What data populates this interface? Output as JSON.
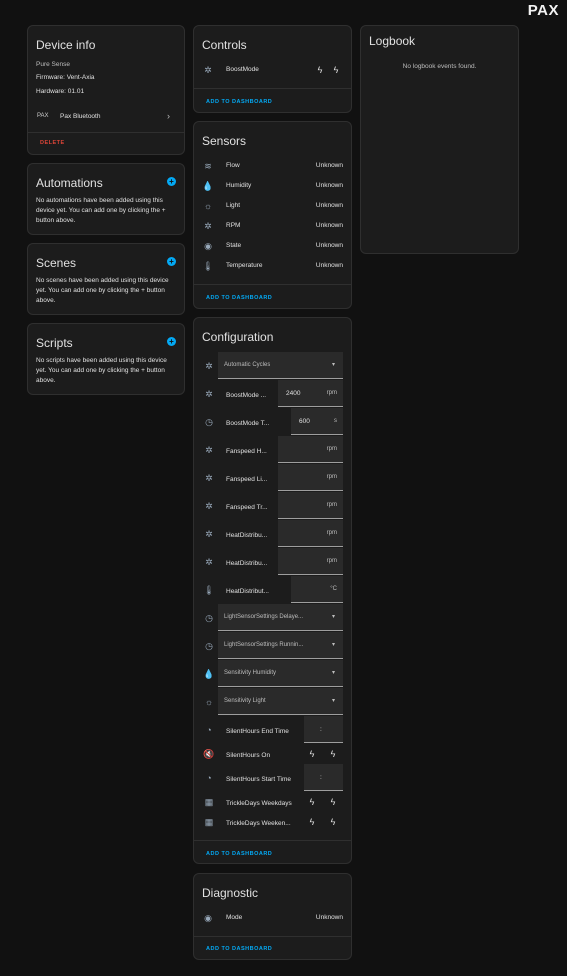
{
  "brand": {
    "logo_text": "PAX"
  },
  "device_info": {
    "title": "Device info",
    "model": "Pure Sense",
    "firmware": "Firmware: Vent-Axia",
    "hardware": "Hardware: 01.01",
    "integration_logo": "PAX",
    "integration_name": "Pax Bluetooth",
    "delete_label": "DELETE"
  },
  "automations": {
    "title": "Automations",
    "text": "No automations have been added using this device yet. You can add one by clicking the + button above."
  },
  "scenes": {
    "title": "Scenes",
    "text": "No scenes have been added using this device yet. You can add one by clicking the + button above."
  },
  "scripts": {
    "title": "Scripts",
    "text": "No scripts have been added using this device yet. You can add one by clicking the + button above."
  },
  "controls": {
    "title": "Controls",
    "items": [
      {
        "name": "BoostMode",
        "icon": "fan-off-icon"
      }
    ],
    "add_label": "ADD TO DASHBOARD"
  },
  "sensors": {
    "title": "Sensors",
    "items": [
      {
        "name": "Flow",
        "state": "Unknown",
        "icon": "wind-icon"
      },
      {
        "name": "Humidity",
        "state": "Unknown",
        "icon": "water-drop-icon"
      },
      {
        "name": "Light",
        "state": "Unknown",
        "icon": "brightness-icon"
      },
      {
        "name": "RPM",
        "state": "Unknown",
        "icon": "fan-icon"
      },
      {
        "name": "State",
        "state": "Unknown",
        "icon": "eye-icon"
      },
      {
        "name": "Temperature",
        "state": "Unknown",
        "icon": "thermometer-icon"
      }
    ],
    "add_label": "ADD TO DASHBOARD"
  },
  "configuration": {
    "title": "Configuration",
    "automatic_cycles": "Automatic Cycles",
    "boost_speed": {
      "name": "BoostMode ...",
      "value": "2400",
      "unit": "rpm"
    },
    "boost_time": {
      "name": "BoostMode T...",
      "value": "600",
      "unit": "s"
    },
    "fanspeed_h": {
      "name": "Fanspeed H...",
      "value": "",
      "unit": "rpm"
    },
    "fanspeed_li": {
      "name": "Fanspeed Li...",
      "value": "",
      "unit": "rpm"
    },
    "fanspeed_tr": {
      "name": "Fanspeed Tr...",
      "value": "",
      "unit": "rpm"
    },
    "heat_1": {
      "name": "HeatDistribu...",
      "value": "",
      "unit": "rpm"
    },
    "heat_2": {
      "name": "HeatDistribu...",
      "value": "",
      "unit": "rpm"
    },
    "heat_3": {
      "name": "HeatDistribut...",
      "value": "",
      "unit": "°C"
    },
    "light_delay": "LightSensorSettings Delaye...",
    "light_running": "LightSensorSettings Runnin...",
    "sens_humidity": "Sensitivity Humidity",
    "sens_light": "Sensitivity Light",
    "silent_end": {
      "name": "SilentHours End Time",
      "value": ":"
    },
    "silent_on": {
      "name": "SilentHours On"
    },
    "silent_start": {
      "name": "SilentHours Start Time",
      "value": ":"
    },
    "trickle_weekdays": {
      "name": "TrickleDays Weekdays"
    },
    "trickle_weekend": {
      "name": "TrickleDays Weeken..."
    },
    "add_label": "ADD TO DASHBOARD"
  },
  "diagnostic": {
    "title": "Diagnostic",
    "items": [
      {
        "name": "Mode",
        "state": "Unknown",
        "icon": "eye-icon"
      }
    ],
    "add_label": "ADD TO DASHBOARD"
  },
  "logbook": {
    "title": "Logbook",
    "empty": "No logbook events found."
  },
  "colors": {
    "background": "#111111",
    "card": "#1c1c1c",
    "accent": "#03a9f4",
    "danger": "#db4437"
  }
}
